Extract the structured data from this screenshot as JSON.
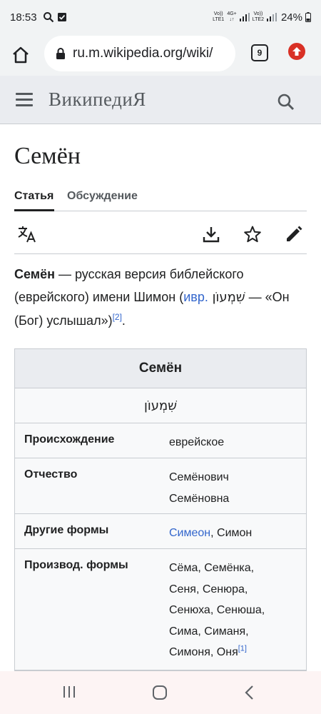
{
  "status_bar": {
    "time": "18:53",
    "net1_top": "Vo))",
    "net1_bottom": "LTE1",
    "net2_top": "4G+",
    "net3_top": "Vo))",
    "net3_bottom": "LTE2",
    "battery": "24%"
  },
  "browser": {
    "url": "ru.m.wikipedia.org/wiki/",
    "tab_count": "9"
  },
  "wiki_header": {
    "logo": "ВикипедиЯ"
  },
  "article": {
    "title": "Семён",
    "tabs": [
      {
        "label": "Статья"
      },
      {
        "label": "Обсуждение"
      }
    ],
    "lead": {
      "bold": "Семён",
      "text1": " — русская версия библейского (еврейского) имени Шимон (",
      "link": "ивр.",
      "hebrew": " שִׁמְעוֹן",
      "text2": " — «Он (Бог) услышал»)",
      "ref": "[2]",
      "end": "."
    }
  },
  "infobox": {
    "title": "Семён",
    "native": "שִׁמְעוֹן",
    "rows": [
      {
        "label": "Происхождение",
        "value": "еврейское"
      },
      {
        "label": "Отчество",
        "value_line1": "Семёнович",
        "value_line2": "Семёновна"
      },
      {
        "label": "Другие формы",
        "value_link": "Симеон",
        "value_rest": ", Симон"
      },
      {
        "label": "Производ. формы",
        "line1": "Сёма, Семёнка,",
        "line2": "Сеня, Сенюра,",
        "line3": "Сенюха, Сенюша,",
        "line4": "Сима, Симаня,",
        "line5": "Симоня, Оня",
        "ref": "[1]"
      }
    ]
  },
  "icons": {
    "status": [
      "search-icon",
      "download-done-icon",
      "signal-icon",
      "battery-icon"
    ],
    "browser": [
      "home-icon",
      "lock-icon",
      "tabs-icon",
      "update-icon"
    ],
    "toolbar": [
      "language-icon",
      "download-icon",
      "star-icon",
      "edit-icon"
    ],
    "nav": [
      "recents-icon",
      "home-circle-icon",
      "back-icon"
    ]
  },
  "colors": {
    "link": "#3366cc",
    "header_bg": "#eaecf0",
    "infobox_bg": "#f8f9fa",
    "update": "#d93025"
  }
}
